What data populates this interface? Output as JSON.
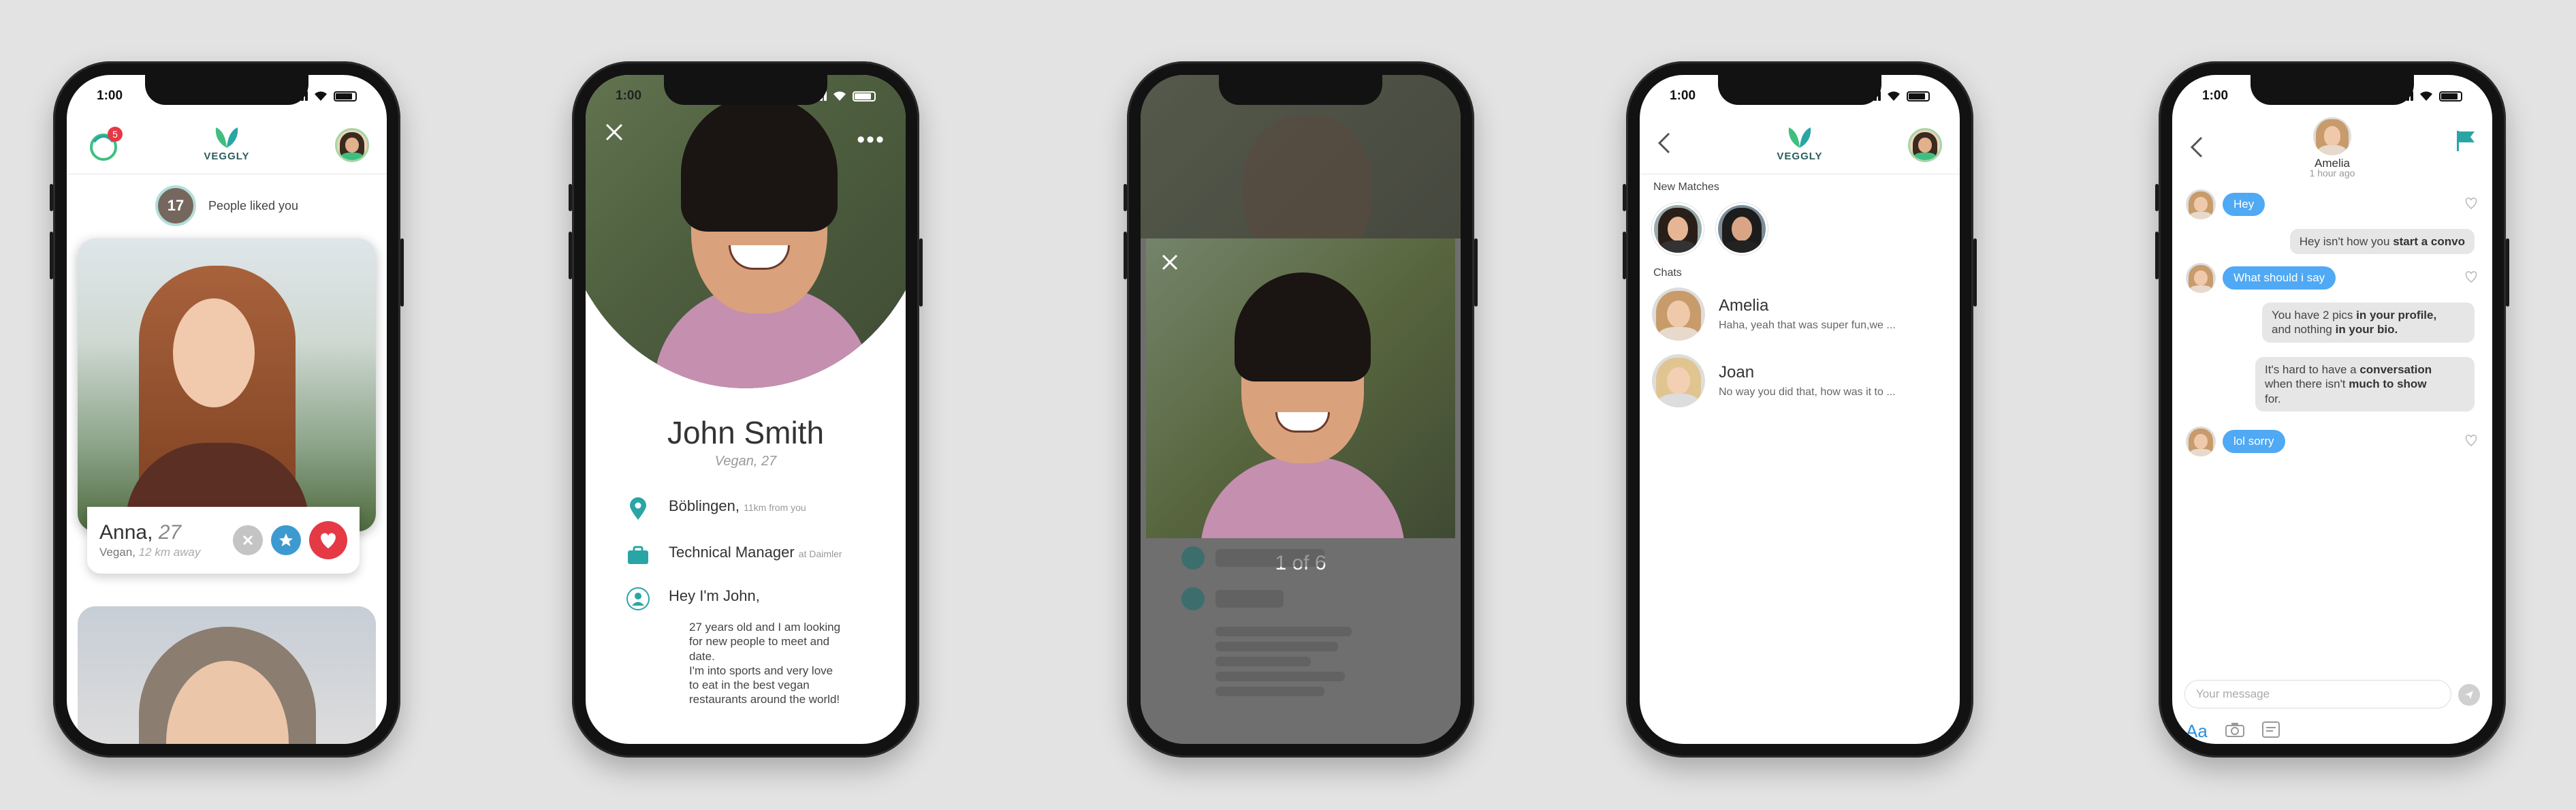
{
  "status_time": "1:00",
  "colors": {
    "accent_blue": "#4fa9f4",
    "brand_green": "#3fbf7f",
    "like_red": "#e53945",
    "teal": "#2aa5a5"
  },
  "screen_discover": {
    "notif_count": "5",
    "logo_text": "VEGGLY",
    "liked_count": "17",
    "liked_text": "People liked you",
    "card": {
      "name": "Anna,",
      "age": "27",
      "diet": "Vegan,",
      "distance": "12 km away"
    }
  },
  "screen_profile": {
    "name": "John Smith",
    "subtitle": "Vegan, 27",
    "location": "Böblingen,",
    "location_distance": "11km from you",
    "job": "Technical Manager",
    "company": "at Daimler",
    "greeting": "Hey I'm John,",
    "bio": [
      "27 years old and I am looking",
      "for new people to meet and",
      "date.",
      "I'm into sports and very love",
      "to eat in the best vegan",
      "restaurants around the world!"
    ]
  },
  "screen_gallery": {
    "pager": "1 of 6"
  },
  "screen_matches": {
    "logo_text": "VEGGLY",
    "new_matches_label": "New Matches",
    "chats_label": "Chats",
    "chats": [
      {
        "name": "Amelia",
        "preview": "Haha, yeah that was super fun,we ..."
      },
      {
        "name": "Joan",
        "preview": "No way you did that, how was it to ..."
      }
    ]
  },
  "screen_chat": {
    "contact": "Amelia",
    "time": "1 hour ago",
    "messages": {
      "m1": "Hey",
      "m2_a": "Hey isn't how you ",
      "m2_b": "start a convo",
      "m3": "What should i say",
      "m4_a": "You have 2 pics ",
      "m4_b": "in your profile,",
      "m4_c": "and nothing ",
      "m4_d": "in your bio.",
      "m5_a": "It's hard to have a ",
      "m5_b": "conversation",
      "m5_c": "when there isn't ",
      "m5_d": "much to show",
      "m5_e": "for.",
      "m6": "lol sorry"
    },
    "input_placeholder": "Your message",
    "aa_label": "Aa"
  }
}
